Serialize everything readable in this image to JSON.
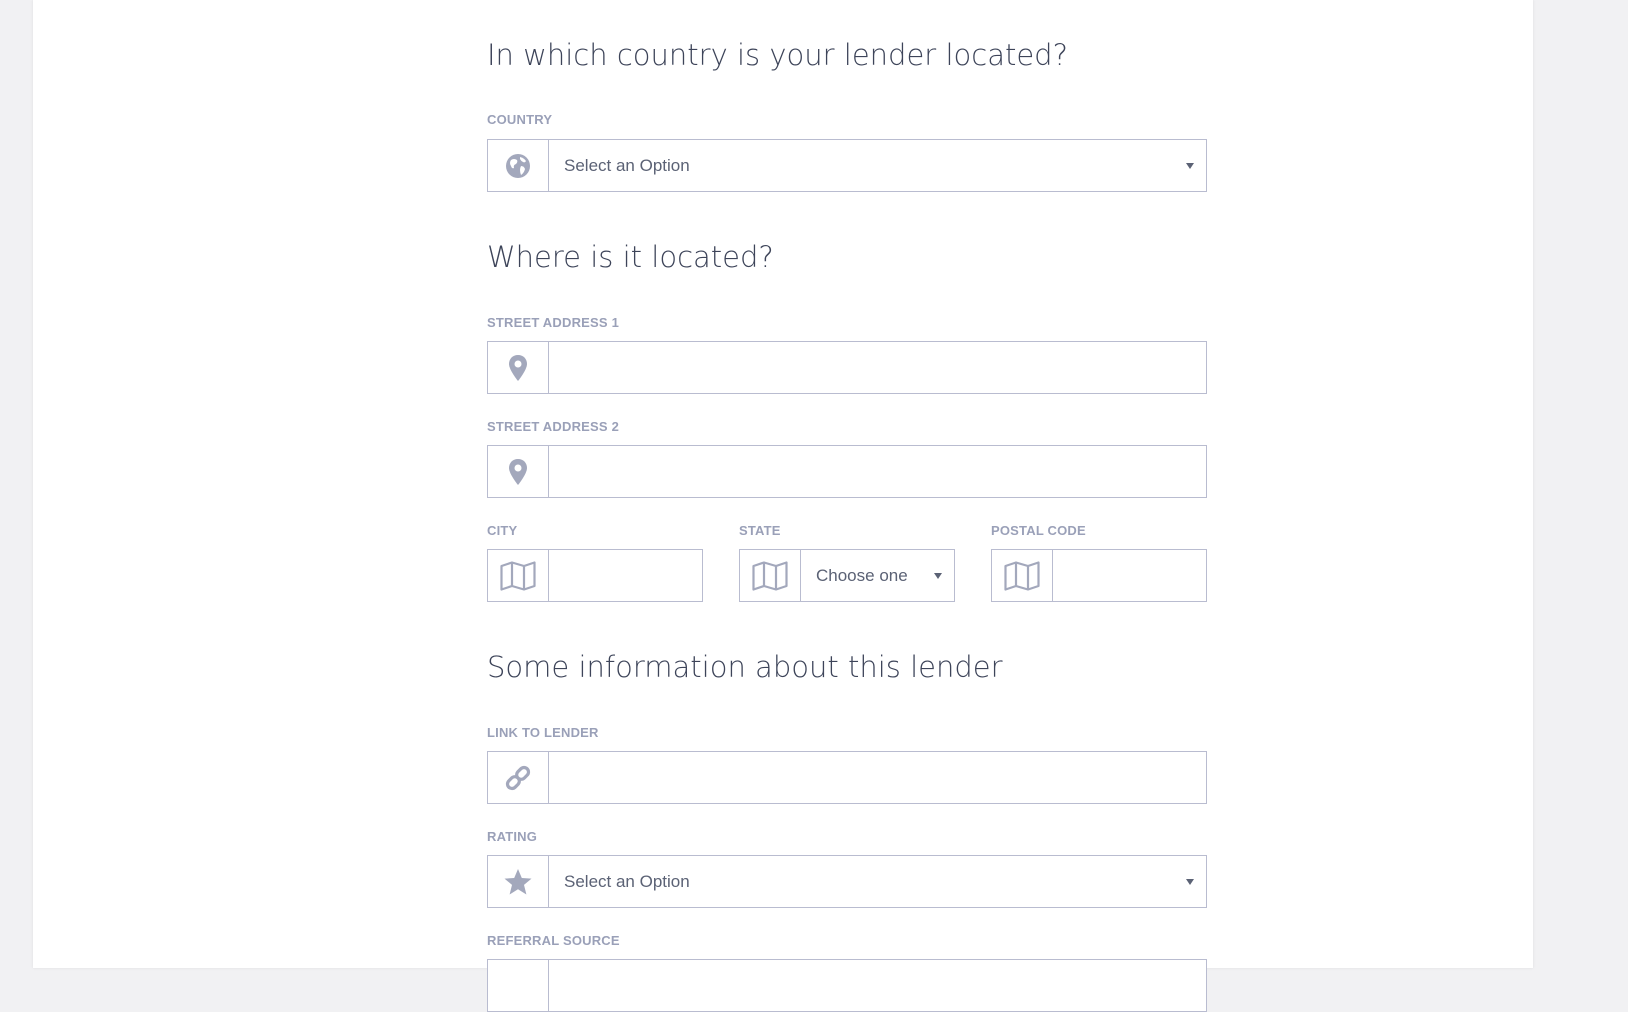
{
  "sections": {
    "country_heading": "In which country is your lender located?",
    "location_heading": "Where is it located?",
    "info_heading": "Some information about this lender"
  },
  "fields": {
    "country": {
      "label": "COUNTRY",
      "value": "Select an Option",
      "icon": "globe-icon"
    },
    "street1": {
      "label": "STREET ADDRESS 1",
      "value": "",
      "icon": "map-pin-icon"
    },
    "street2": {
      "label": "STREET ADDRESS 2",
      "value": "",
      "icon": "map-pin-icon"
    },
    "city": {
      "label": "CITY",
      "value": "",
      "icon": "folded-map-icon"
    },
    "state": {
      "label": "STATE",
      "value": "Choose one",
      "icon": "folded-map-icon"
    },
    "postal": {
      "label": "POSTAL CODE",
      "value": "",
      "icon": "folded-map-icon"
    },
    "link": {
      "label": "LINK TO LENDER",
      "value": "",
      "icon": "link-icon"
    },
    "rating": {
      "label": "RATING",
      "value": "Select an Option",
      "icon": "star-icon"
    },
    "referral": {
      "label": "REFERRAL SOURCE"
    }
  },
  "colors": {
    "border": "#b9bcd0",
    "icon": "#a3a8bc",
    "label": "#9aa0b8",
    "heading": "#3d4459",
    "background": "#f1f1f3"
  }
}
